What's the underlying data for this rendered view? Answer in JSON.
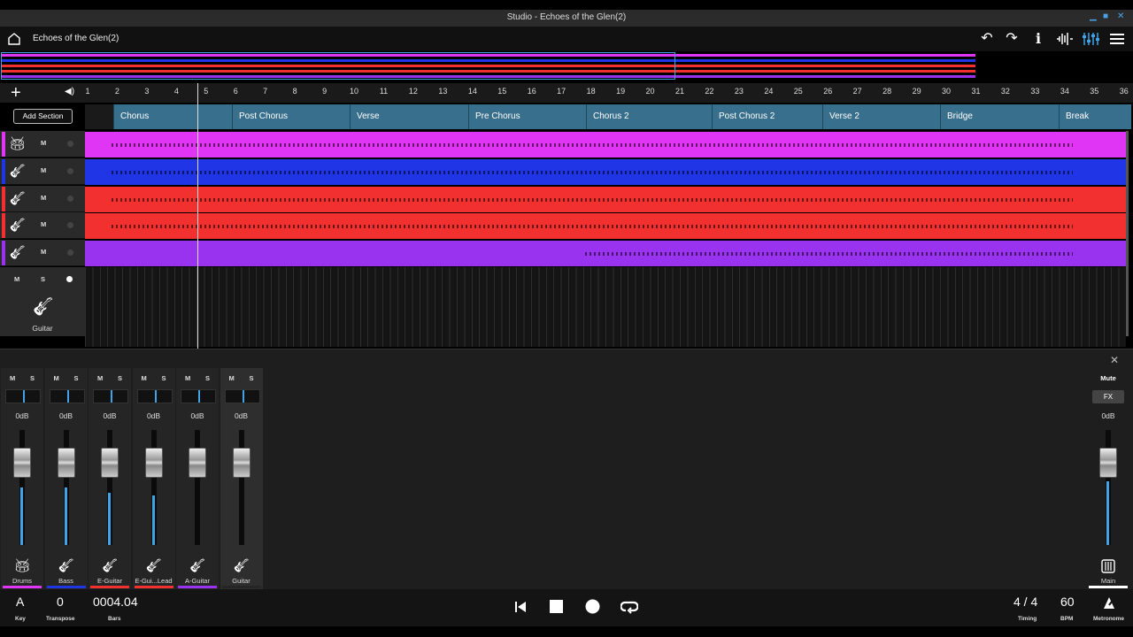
{
  "window": {
    "title": "Studio - Echoes of the Glen(2)"
  },
  "header": {
    "song_title": "Echoes of the Glen(2)"
  },
  "ruler": {
    "bars": [
      "1",
      "2",
      "3",
      "4",
      "5",
      "6",
      "7",
      "8",
      "9",
      "10",
      "11",
      "12",
      "13",
      "14",
      "15",
      "16",
      "17",
      "18",
      "19",
      "20",
      "21",
      "22",
      "23",
      "24",
      "25",
      "26",
      "27",
      "28",
      "29",
      "30",
      "31",
      "32",
      "33",
      "34",
      "35",
      "36"
    ]
  },
  "sections": {
    "add_label": "Add Section",
    "items": [
      {
        "label": "Chorus"
      },
      {
        "label": "Post Chorus"
      },
      {
        "label": "Verse"
      },
      {
        "label": "Pre Chorus"
      },
      {
        "label": "Chorus 2"
      },
      {
        "label": "Post Chorus 2"
      },
      {
        "label": "Verse 2"
      },
      {
        "label": "Bridge"
      },
      {
        "label": "Break"
      }
    ]
  },
  "tracks": [
    {
      "icon": "drums-icon",
      "mute": "M",
      "color": "#e135f5"
    },
    {
      "icon": "guitar-icon",
      "mute": "M",
      "color": "#1f35e6"
    },
    {
      "icon": "guitar-icon",
      "mute": "M",
      "color": "#f23030"
    },
    {
      "icon": "guitar-icon",
      "mute": "M",
      "color": "#f23030"
    },
    {
      "icon": "guitar-icon",
      "mute": "M",
      "color": "#9a33f0"
    }
  ],
  "empty_track": {
    "mute": "M",
    "solo": "S",
    "label": "Guitar",
    "icon": "guitar-icon"
  },
  "mixer": {
    "strips": [
      {
        "name": "Drums",
        "mute": "M",
        "solo": "S",
        "db": "0dB",
        "icon": "drums-icon",
        "color": "#e135f5",
        "level": 0.5
      },
      {
        "name": "Bass",
        "mute": "M",
        "solo": "S",
        "db": "0dB",
        "icon": "guitar-icon",
        "color": "#1f35e6",
        "level": 0.5
      },
      {
        "name": "E-Guitar",
        "mute": "M",
        "solo": "S",
        "db": "0dB",
        "icon": "guitar-icon",
        "color": "#f23030",
        "level": 0.45
      },
      {
        "name": "E-Gui...Lead",
        "mute": "M",
        "solo": "S",
        "db": "0dB",
        "icon": "guitar-icon",
        "color": "#f23030",
        "level": 0.43
      },
      {
        "name": "A-Guitar",
        "mute": "M",
        "solo": "S",
        "db": "0dB",
        "icon": "guitar-icon",
        "color": "#9a33f0",
        "level": 0.0
      },
      {
        "name": "Guitar",
        "mute": "M",
        "solo": "S",
        "db": "0dB",
        "icon": "guitar-icon",
        "color": "#252525",
        "level": 0.0
      }
    ],
    "main": {
      "mute": "Mute",
      "fx": "FX",
      "db": "0dB",
      "name": "Main",
      "icon": "mixer-icon",
      "level": 0.55
    }
  },
  "transport": {
    "key": {
      "value": "A",
      "label": "Key"
    },
    "transpose": {
      "value": "0",
      "label": "Transpose"
    },
    "bars": {
      "value": "0004.04",
      "label": "Bars"
    },
    "timing": {
      "value": "4 / 4",
      "label": "Timing"
    },
    "bpm": {
      "value": "60",
      "label": "BPM"
    },
    "metronome": {
      "label": "Metronome"
    }
  }
}
